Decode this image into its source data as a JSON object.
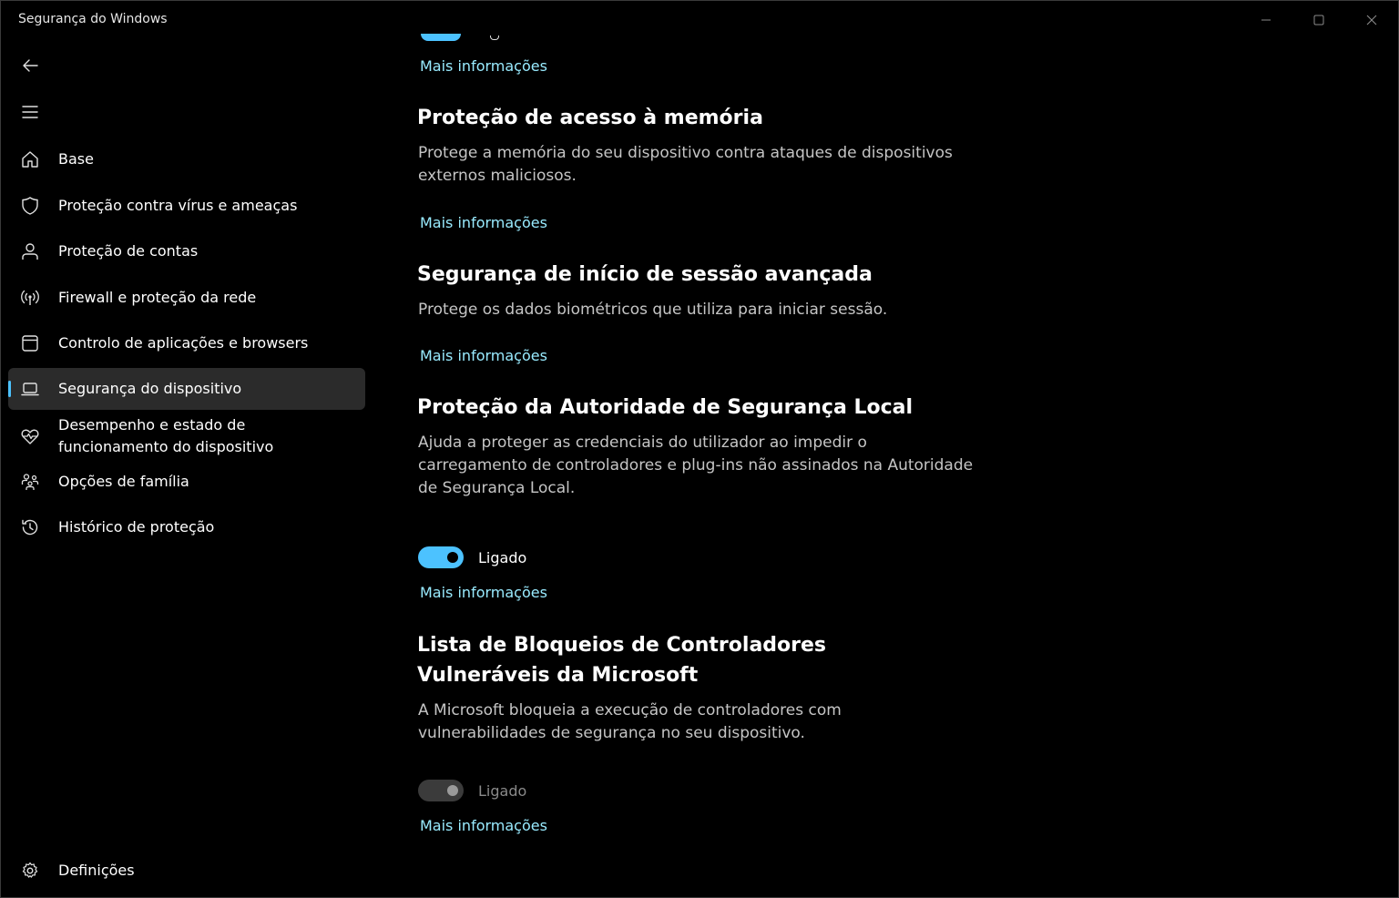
{
  "window": {
    "title": "Segurança do Windows"
  },
  "sidebar": {
    "items": [
      {
        "label": "Base",
        "icon": "home-icon"
      },
      {
        "label": "Proteção contra vírus e ameaças",
        "icon": "shield-icon"
      },
      {
        "label": "Proteção de contas",
        "icon": "person-icon"
      },
      {
        "label": "Firewall e proteção da rede",
        "icon": "wifi-antenna-icon"
      },
      {
        "label": "Controlo de aplicações e browsers",
        "icon": "app-window-icon"
      },
      {
        "label": "Segurança do dispositivo",
        "icon": "laptop-icon",
        "selected": true
      },
      {
        "label": "Desempenho e estado de funcionamento do dispositivo",
        "icon": "heart-pulse-icon"
      },
      {
        "label": "Opções de família",
        "icon": "family-icon"
      },
      {
        "label": "Histórico de proteção",
        "icon": "history-icon"
      }
    ],
    "settings_label": "Definições"
  },
  "main": {
    "top_link": "Mais informações",
    "sections": [
      {
        "title": "Proteção de acesso à memória",
        "description": "Protege a memória do seu dispositivo contra ataques de dispositivos externos maliciosos.",
        "link": "Mais informações"
      },
      {
        "title": "Segurança de início de sessão avançada",
        "description": "Protege os dados biométricos que utiliza para iniciar sessão.",
        "link": "Mais informações"
      },
      {
        "title": "Proteção da Autoridade de Segurança Local",
        "description": "Ajuda a proteger as credenciais do utilizador ao impedir o carregamento de controladores e plug-ins não assinados na Autoridade de Segurança Local.",
        "toggle_label": "Ligado",
        "toggle_state": "on",
        "link": "Mais informações"
      },
      {
        "title": "Lista de Bloqueios de Controladores Vulneráveis da Microsoft",
        "description": "A Microsoft bloqueia a execução de controladores com vulnerabilidades de segurança no seu dispositivo.",
        "toggle_label": "Ligado",
        "toggle_state": "disabled",
        "link": "Mais informações"
      }
    ]
  },
  "colors": {
    "accent": "#4cc2ff",
    "link": "#99ebff",
    "background": "#000000",
    "selected_bg": "#2b2b2b"
  }
}
